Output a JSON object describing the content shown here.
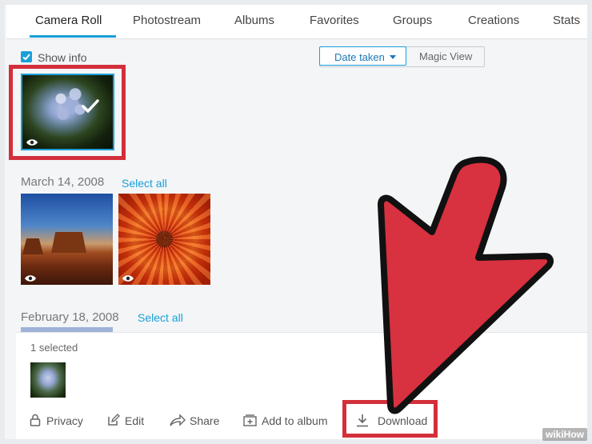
{
  "tabs": [
    {
      "label": "Camera Roll",
      "active": true
    },
    {
      "label": "Photostream"
    },
    {
      "label": "Albums"
    },
    {
      "label": "Favorites"
    },
    {
      "label": "Groups"
    },
    {
      "label": "Creations"
    },
    {
      "label": "Stats"
    }
  ],
  "toolbar": {
    "show_info_label": "Show info",
    "show_info_checked": true,
    "sort_label": "Date taken",
    "magic_view_label": "Magic View"
  },
  "sections": [
    {
      "date": "March 14, 2008",
      "select_all": "Select all"
    },
    {
      "date": "February 18, 2008",
      "select_all": "Select all"
    }
  ],
  "selection_bar": {
    "selected_count": "1 selected",
    "actions": [
      {
        "label": "Privacy",
        "icon": "lock-icon"
      },
      {
        "label": "Edit",
        "icon": "edit-icon"
      },
      {
        "label": "Share",
        "icon": "share-icon"
      },
      {
        "label": "Add to album",
        "icon": "add-to-album-icon"
      },
      {
        "label": "Download",
        "icon": "download-icon"
      }
    ]
  },
  "colors": {
    "accent": "#1a9fd9",
    "highlight_red": "#d32f3a",
    "arrow_red": "#d8313f"
  },
  "watermark": "wikiHow"
}
